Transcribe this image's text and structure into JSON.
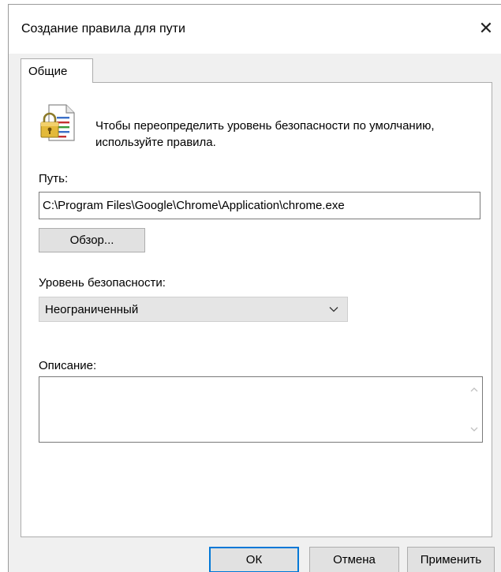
{
  "window": {
    "title": "Создание правила для пути",
    "close_symbol": "✕"
  },
  "tabs": [
    {
      "label": "Общие",
      "selected": true
    }
  ],
  "info": {
    "icon": "lock-document-icon",
    "text": "Чтобы переопределить уровень безопасности по умолчанию, используйте правила."
  },
  "path": {
    "label": "Путь:",
    "value": "C:\\Program Files\\Google\\Chrome\\Application\\chrome.exe",
    "browse_label": "Обзор..."
  },
  "security": {
    "label": "Уровень безопасности:",
    "selected": "Неограниченный"
  },
  "description": {
    "label": "Описание:",
    "value": ""
  },
  "footer": {
    "ok_label": "ОК",
    "cancel_label": "Отмена",
    "apply_label": "Применить"
  },
  "colors": {
    "accent": "#0078d7",
    "dialog_bg": "#f0f0f0",
    "button_bg": "#e1e1e1"
  }
}
